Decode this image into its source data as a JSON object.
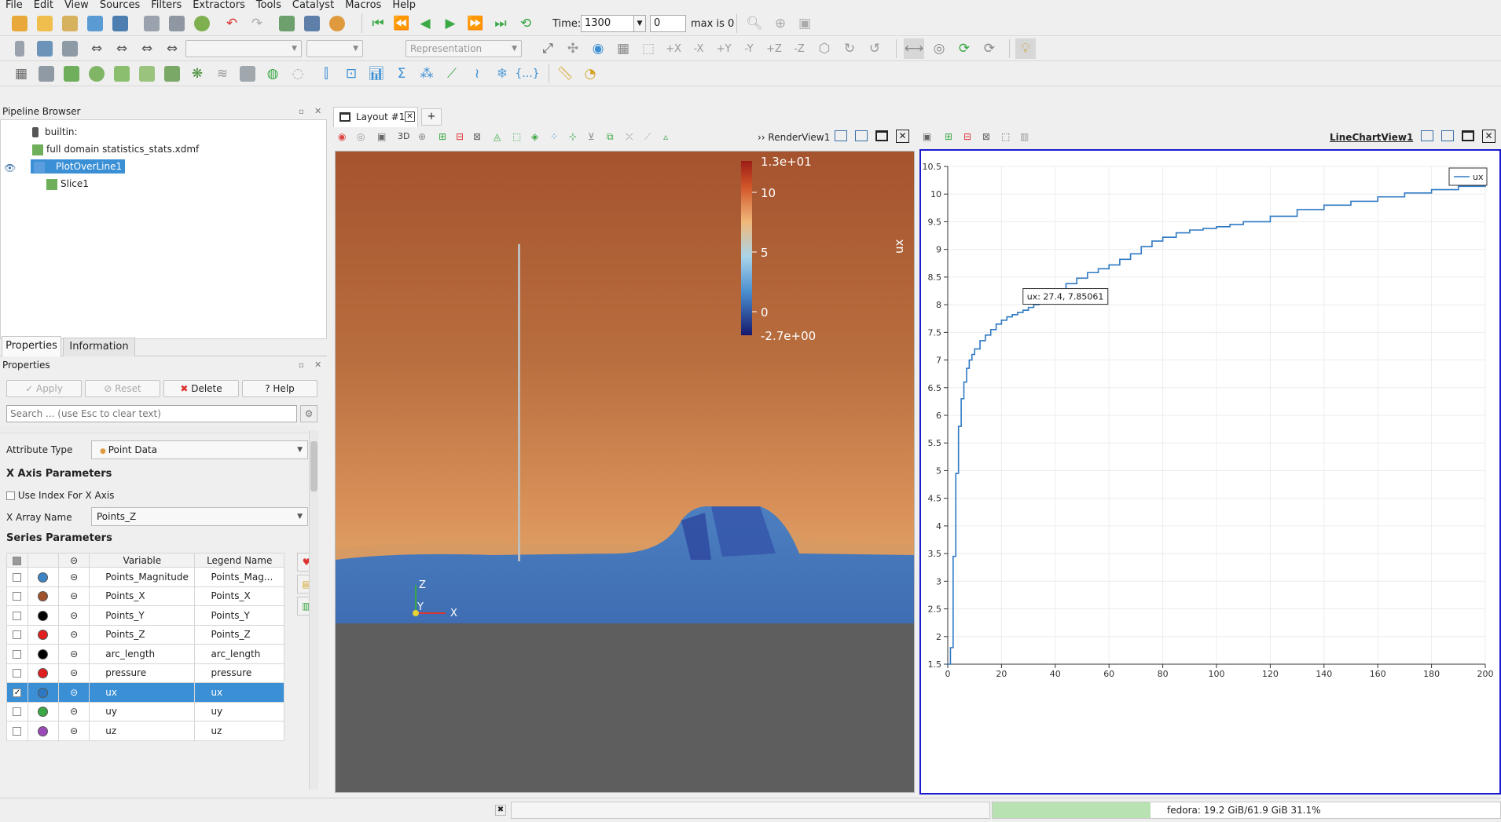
{
  "menu": [
    "File",
    "Edit",
    "View",
    "Sources",
    "Filters",
    "Extractors",
    "Tools",
    "Catalyst",
    "Macros",
    "Help"
  ],
  "time_toolbar": {
    "label": "Time:",
    "value": "1300",
    "step": "0",
    "max_text": "max is 0"
  },
  "combos": {
    "representation": "Representation"
  },
  "pipeline": {
    "title": "Pipeline Browser",
    "items": [
      {
        "label": "builtin:"
      },
      {
        "label": "full domain statistics_stats.xdmf"
      },
      {
        "label": "PlotOverLine1"
      },
      {
        "label": "Slice1"
      }
    ]
  },
  "tabs": {
    "properties": "Properties",
    "information": "Information"
  },
  "properties": {
    "title": "Properties",
    "apply": "Apply",
    "reset": "Reset",
    "delete": "Delete",
    "help": "Help",
    "search_placeholder": "Search ... (use Esc to clear text)",
    "attribute_type_label": "Attribute Type",
    "attribute_type_value": "Point Data",
    "x_axis_header": "X Axis Parameters",
    "use_index_label": "Use Index For X Axis",
    "x_array_label": "X Array Name",
    "x_array_value": "Points_Z",
    "series_header": "Series Parameters",
    "col_variable": "Variable",
    "col_legend": "Legend Name"
  },
  "series": [
    {
      "variable": "Points_Magnitude",
      "legend": "Points_Mag...",
      "color": "#3d84c6",
      "checked": false
    },
    {
      "variable": "Points_X",
      "legend": "Points_X",
      "color": "#a0522d",
      "checked": false
    },
    {
      "variable": "Points_Y",
      "legend": "Points_Y",
      "color": "#000000",
      "checked": false
    },
    {
      "variable": "Points_Z",
      "legend": "Points_Z",
      "color": "#e02020",
      "checked": false
    },
    {
      "variable": "arc_length",
      "legend": "arc_length",
      "color": "#000000",
      "checked": false
    },
    {
      "variable": "pressure",
      "legend": "pressure",
      "color": "#e02020",
      "checked": false
    },
    {
      "variable": "ux",
      "legend": "ux",
      "color": "#2f79c4",
      "checked": true
    },
    {
      "variable": "uy",
      "legend": "uy",
      "color": "#3aa845",
      "checked": false
    },
    {
      "variable": "uz",
      "legend": "uz",
      "color": "#9b49b8",
      "checked": false
    }
  ],
  "layout": {
    "tab": "Layout #1",
    "add": "+",
    "render_view": "RenderView1",
    "line_chart_view": "LineChartView1",
    "three_d": "3D"
  },
  "colorbar": {
    "title": "ux",
    "max": "1.3e+01",
    "ticks": [
      "10",
      "5",
      "0"
    ],
    "min": "-2.7e+00"
  },
  "axes_labels": {
    "z": "Z",
    "y": "Y",
    "x": "X"
  },
  "status": {
    "memory": "fedora: 19.2 GiB/61.9 GiB 31.1%",
    "memory_fraction": 0.311
  },
  "chart_data": {
    "type": "line",
    "title": "",
    "xlabel": "",
    "ylabel": "",
    "xlim": [
      0,
      200
    ],
    "ylim": [
      1.5,
      10.5
    ],
    "x_ticks": [
      "0",
      "20",
      "40",
      "60",
      "80",
      "100",
      "120",
      "140",
      "160",
      "180",
      "200"
    ],
    "y_ticks": [
      "1.5",
      "2",
      "2.5",
      "3",
      "3.5",
      "4",
      "4.5",
      "5",
      "5.5",
      "6",
      "6.5",
      "7",
      "7.5",
      "8",
      "8.5",
      "9",
      "9.5",
      "10",
      "10.5"
    ],
    "grid": true,
    "legend_position": "top-right",
    "tooltip": "ux: 27.4,  7.85061",
    "series": [
      {
        "name": "ux",
        "color": "#2f79c4",
        "x": [
          0,
          1,
          2,
          3,
          4,
          5,
          6,
          7,
          8,
          9,
          10,
          12,
          14,
          16,
          18,
          20,
          22,
          24,
          26,
          28,
          30,
          32,
          34,
          36,
          38,
          40,
          44,
          48,
          52,
          56,
          60,
          64,
          68,
          72,
          76,
          80,
          85,
          90,
          95,
          100,
          105,
          110,
          120,
          130,
          140,
          150,
          160,
          170,
          180,
          190,
          200
        ],
        "y": [
          1.5,
          1.8,
          3.45,
          4.95,
          5.8,
          6.3,
          6.6,
          6.85,
          7.0,
          7.1,
          7.2,
          7.35,
          7.45,
          7.55,
          7.65,
          7.72,
          7.78,
          7.82,
          7.86,
          7.9,
          7.95,
          8.0,
          8.1,
          8.17,
          8.22,
          8.27,
          8.38,
          8.48,
          8.58,
          8.65,
          8.72,
          8.82,
          8.92,
          9.05,
          9.15,
          9.22,
          9.3,
          9.35,
          9.38,
          9.41,
          9.45,
          9.5,
          9.6,
          9.72,
          9.8,
          9.87,
          9.95,
          10.02,
          10.08,
          10.14,
          10.2
        ]
      }
    ]
  }
}
